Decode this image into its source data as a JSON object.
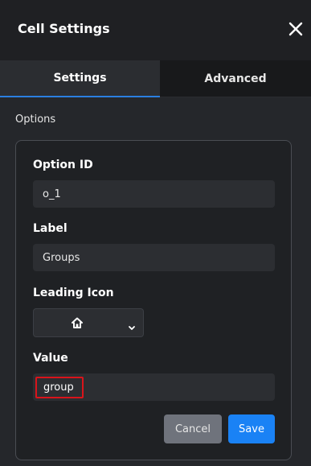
{
  "header": {
    "title": "Cell Settings",
    "close_icon": "close-icon"
  },
  "tabs": [
    {
      "label": "Settings",
      "active": true
    },
    {
      "label": "Advanced",
      "active": false
    }
  ],
  "colors": {
    "accent": "#1a82f5",
    "highlight": "#d9141b"
  },
  "options": {
    "section_label": "Options",
    "option_id": {
      "label": "Option ID",
      "value": "o_1"
    },
    "label_field": {
      "label": "Label",
      "value": "Groups"
    },
    "leading_icon": {
      "label": "Leading Icon",
      "selected_icon": "home-icon"
    },
    "value_field": {
      "label": "Value",
      "value": "group"
    },
    "buttons": {
      "cancel": "Cancel",
      "save": "Save"
    }
  }
}
